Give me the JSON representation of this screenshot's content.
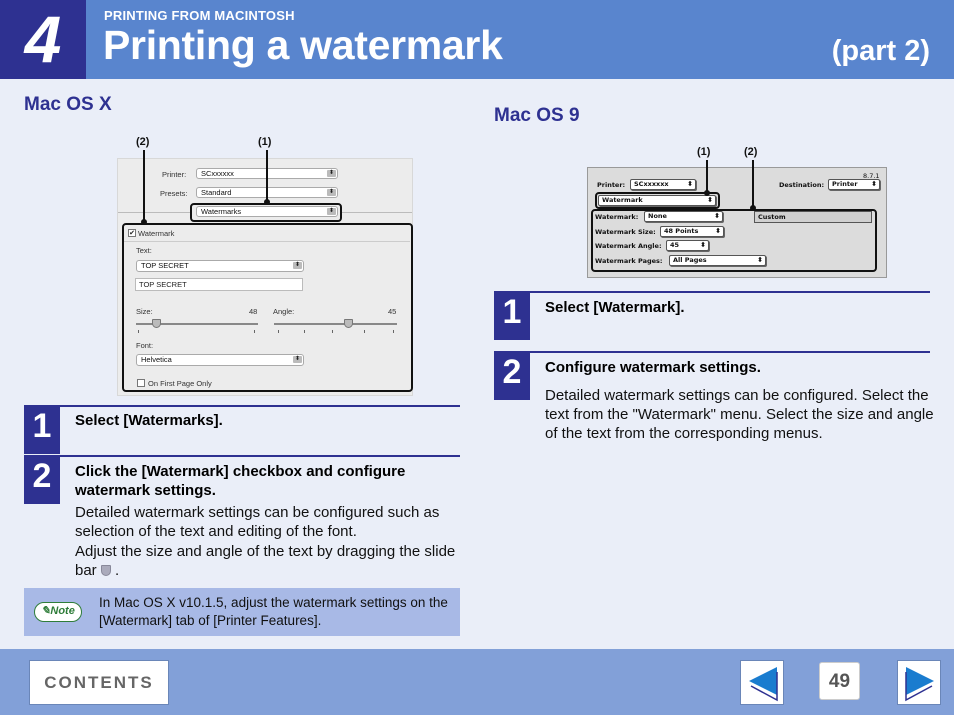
{
  "header": {
    "chapter_number": "4",
    "section": "PRINTING FROM MACINTOSH",
    "title": "Printing a watermark",
    "part": "(part 2)"
  },
  "mac_os_x": {
    "heading": "Mac OS X",
    "screenshot": {
      "callout_1": "(1)",
      "callout_2": "(2)",
      "printer_label": "Printer:",
      "printer_value": "SCxxxxxx",
      "presets_label": "Presets:",
      "presets_value": "Standard",
      "panel_value": "Watermarks",
      "watermark_checkbox_label": "Watermark",
      "watermark_checked": true,
      "text_label": "Text:",
      "text_select_value": "TOP SECRET",
      "text_input_value": "TOP SECRET",
      "size_label": "Size:",
      "size_value": "48",
      "angle_label": "Angle:",
      "angle_value": "45",
      "font_label": "Font:",
      "font_value": "Helvetica",
      "first_page_only_label": "On First Page Only",
      "first_page_only_checked": false,
      "arrows_glyph": "⬍",
      "check_glyph": "✔"
    },
    "steps": [
      {
        "number": "1",
        "title": "Select [Watermarks]."
      },
      {
        "number": "2",
        "title": "Click the [Watermark] checkbox and configure watermark settings.",
        "body_1": "Detailed watermark settings can be configured such as selection of the text and editing of the font.",
        "body_2_prefix": "Adjust the size and angle of the text by dragging the slide bar",
        "body_2_suffix": "."
      }
    ],
    "note": {
      "badge": "Note",
      "text": "In Mac OS X v10.1.5, adjust the watermark settings on the [Watermark] tab of [Printer Features]."
    }
  },
  "mac_os_9": {
    "heading": "Mac OS 9",
    "screenshot": {
      "callout_1": "(1)",
      "callout_2": "(2)",
      "version": "8.7.1",
      "printer_label": "Printer:",
      "printer_value": "SCxxxxxx",
      "destination_label": "Destination:",
      "destination_value": "Printer",
      "panel_value": "Watermark",
      "watermark_label": "Watermark:",
      "watermark_value": "None",
      "custom_button": "Custom",
      "size_label": "Watermark Size:",
      "size_value": "48 Points",
      "angle_label": "Watermark Angle:",
      "angle_value": "45",
      "pages_label": "Watermark Pages:",
      "pages_value": "All Pages",
      "arrows_glyph": "⬍"
    },
    "steps": [
      {
        "number": "1",
        "title": "Select [Watermark]."
      },
      {
        "number": "2",
        "title": "Configure watermark settings.",
        "body": "Detailed watermark settings can be configured. Select the text from the \"Watermark\" menu. Select the size and angle of the text from the corresponding menus."
      }
    ]
  },
  "footer": {
    "contents_label": "CONTENTS",
    "page_number": "49",
    "prev_icon": "left-arrow-icon",
    "next_icon": "right-arrow-icon"
  },
  "colors": {
    "brand_dark": "#2e3191",
    "header_blue": "#5985ce",
    "footer_blue": "#82a0d8",
    "note_bg": "#a8b9e6",
    "nav_arrow": "#1a7ccf"
  }
}
